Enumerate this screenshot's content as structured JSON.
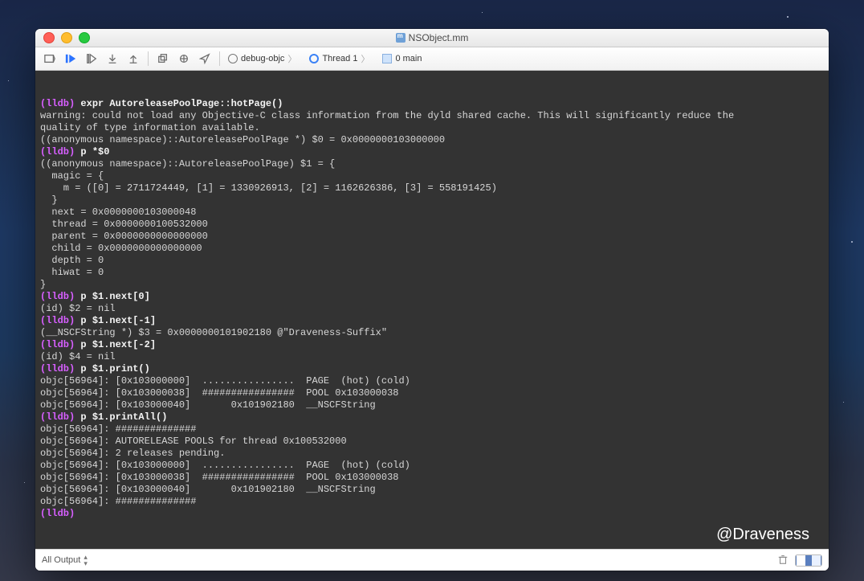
{
  "window": {
    "title": "NSObject.mm"
  },
  "toolbar": {
    "breadcrumb": {
      "scheme": "debug-objc",
      "thread": "Thread 1",
      "frame": "0 main"
    }
  },
  "console": {
    "lines": [
      {
        "kind": "cmd",
        "prompt": "(lldb) ",
        "text": "expr AutoreleasePoolPage::hotPage()"
      },
      {
        "kind": "out",
        "text": "warning: could not load any Objective-C class information from the dyld shared cache. This will significantly reduce the"
      },
      {
        "kind": "out",
        "text": "quality of type information available."
      },
      {
        "kind": "out",
        "text": "((anonymous namespace)::AutoreleasePoolPage *) $0 = 0x0000000103000000"
      },
      {
        "kind": "cmd",
        "prompt": "(lldb) ",
        "text": "p *$0"
      },
      {
        "kind": "out",
        "text": "((anonymous namespace)::AutoreleasePoolPage) $1 = {"
      },
      {
        "kind": "out",
        "text": "  magic = {"
      },
      {
        "kind": "out",
        "text": "    m = ([0] = 2711724449, [1] = 1330926913, [2] = 1162626386, [3] = 558191425)"
      },
      {
        "kind": "out",
        "text": "  }"
      },
      {
        "kind": "out",
        "text": "  next = 0x0000000103000048"
      },
      {
        "kind": "out",
        "text": "  thread = 0x0000000100532000"
      },
      {
        "kind": "out",
        "text": "  parent = 0x0000000000000000"
      },
      {
        "kind": "out",
        "text": "  child = 0x0000000000000000"
      },
      {
        "kind": "out",
        "text": "  depth = 0"
      },
      {
        "kind": "out",
        "text": "  hiwat = 0"
      },
      {
        "kind": "out",
        "text": "}"
      },
      {
        "kind": "cmd",
        "prompt": "(lldb) ",
        "text": "p $1.next[0]"
      },
      {
        "kind": "out",
        "text": "(id) $2 = nil"
      },
      {
        "kind": "cmd",
        "prompt": "(lldb) ",
        "text": "p $1.next[-1]"
      },
      {
        "kind": "out",
        "text": "(__NSCFString *) $3 = 0x0000000101902180 @\"Draveness-Suffix\""
      },
      {
        "kind": "cmd",
        "prompt": "(lldb) ",
        "text": "p $1.next[-2]"
      },
      {
        "kind": "out",
        "text": "(id) $4 = nil"
      },
      {
        "kind": "cmd",
        "prompt": "(lldb) ",
        "text": "p $1.print()"
      },
      {
        "kind": "out",
        "text": "objc[56964]: [0x103000000]  ................  PAGE  (hot) (cold)"
      },
      {
        "kind": "out",
        "text": "objc[56964]: [0x103000038]  ################  POOL 0x103000038"
      },
      {
        "kind": "out",
        "text": "objc[56964]: [0x103000040]       0x101902180  __NSCFString"
      },
      {
        "kind": "cmd",
        "prompt": "(lldb) ",
        "text": "p $1.printAll()"
      },
      {
        "kind": "out",
        "text": "objc[56964]: ##############"
      },
      {
        "kind": "out",
        "text": "objc[56964]: AUTORELEASE POOLS for thread 0x100532000"
      },
      {
        "kind": "out",
        "text": "objc[56964]: 2 releases pending."
      },
      {
        "kind": "out",
        "text": "objc[56964]: [0x103000000]  ................  PAGE  (hot) (cold)"
      },
      {
        "kind": "out",
        "text": "objc[56964]: [0x103000038]  ################  POOL 0x103000038"
      },
      {
        "kind": "out",
        "text": "objc[56964]: [0x103000040]       0x101902180  __NSCFString"
      },
      {
        "kind": "out",
        "text": "objc[56964]: ##############"
      },
      {
        "kind": "cmd",
        "prompt": "(lldb) ",
        "text": ""
      }
    ],
    "watermark": "@Draveness"
  },
  "footer": {
    "filter_label": "All Output"
  }
}
